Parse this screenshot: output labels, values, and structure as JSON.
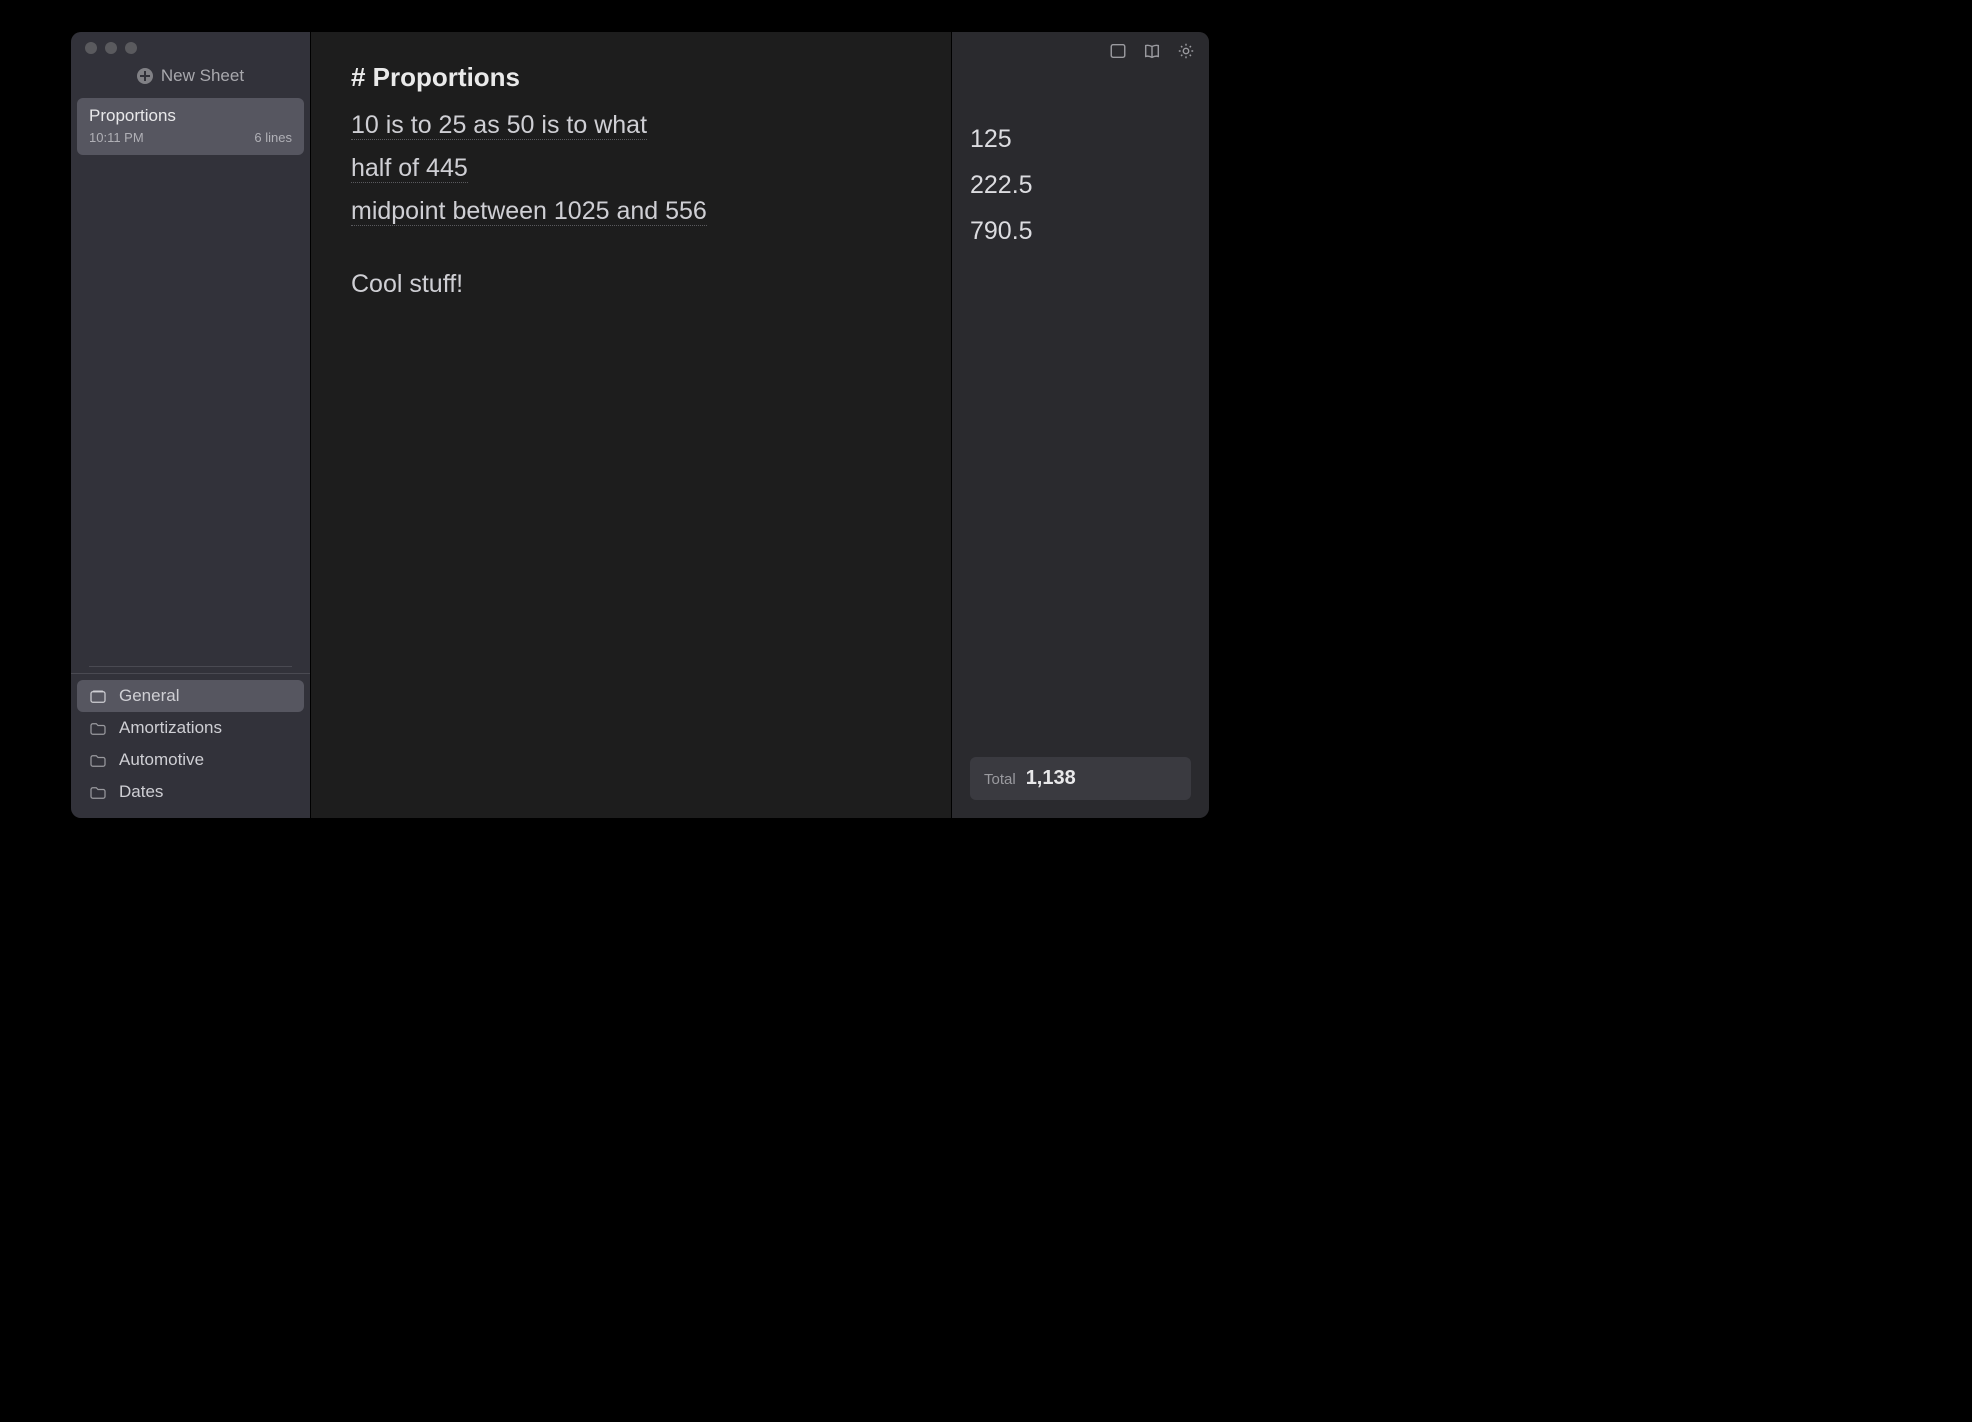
{
  "newSheetLabel": "New Sheet",
  "sheets": [
    {
      "title": "Proportions",
      "time": "10:11 PM",
      "lineCount": "6 lines"
    }
  ],
  "folders": [
    {
      "label": "General",
      "icon": "stack",
      "selected": true
    },
    {
      "label": "Amortizations",
      "icon": "folder",
      "selected": false
    },
    {
      "label": "Automotive",
      "icon": "folder",
      "selected": false
    },
    {
      "label": "Dates",
      "icon": "folder",
      "selected": false
    }
  ],
  "editor": {
    "heading": "# Proportions",
    "lines": [
      {
        "text": "10 is to 25 as 50 is to what",
        "result": "125"
      },
      {
        "text": "half of 445",
        "result": "222.5"
      },
      {
        "text": "midpoint between 1025 and 556",
        "result": "790.5"
      }
    ],
    "comment": "Cool stuff!"
  },
  "total": {
    "label": "Total",
    "value": "1,138"
  }
}
